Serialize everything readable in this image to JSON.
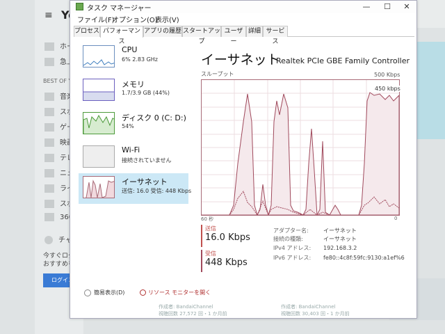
{
  "browser": {
    "menu_icon": "hamburger-icon",
    "logo": "Yo",
    "nav_items": [
      "ホー",
      "急上"
    ],
    "section_title": "BEST OF YO",
    "categories": [
      "音楽",
      "スポ",
      "ゲー",
      "映画",
      "テレ",
      "ニュ",
      "ライ",
      "スポ",
      "360"
    ],
    "channels_label": "チャ",
    "promo_line1": "今すぐログ",
    "promo_line2": "おすすめを",
    "login_button": "ログイン"
  },
  "window": {
    "title": "タスク マネージャー",
    "menu": [
      "ファイル(F)",
      "オプション(O)",
      "表示(V)"
    ],
    "tabs": [
      "プロセス",
      "パフォーマンス",
      "アプリの履歴",
      "スタートアップ",
      "ユーザー",
      "詳細",
      "サービス"
    ],
    "active_tab": "パフォーマンス"
  },
  "perf_items": [
    {
      "name": "CPU",
      "sub": "6% 2.83 GHz"
    },
    {
      "name": "メモリ",
      "sub": "1.7/3.9 GB (44%)"
    },
    {
      "name": "ディスク 0 (C: D:)",
      "sub": "54%"
    },
    {
      "name": "Wi-Fi",
      "sub": "接続されていません"
    },
    {
      "name": "イーサネット",
      "sub": "送信: 16.0 受信: 448 Kbps"
    }
  ],
  "pane": {
    "title": "イーサネット",
    "adapter": "Realtek PCIe GBE Family Controller",
    "throughput_label": "スループット",
    "max_label": "500 Kbps",
    "scale_label": "450 kbps",
    "axis_left": "60 秒",
    "axis_right": "0"
  },
  "stats": {
    "send_label": "送信",
    "send_value": "16.0 Kbps",
    "recv_label": "受信",
    "recv_value": "448 Kbps"
  },
  "details": [
    {
      "k": "アダプター名:",
      "v": "イーサネット"
    },
    {
      "k": "接続の種類:",
      "v": "イーサネット"
    },
    {
      "k": "IPv4 アドレス:",
      "v": "192.168.3.2"
    },
    {
      "k": "IPv6 アドレス:",
      "v": "fe80::4c8f:59fc:9130:a1ef%6"
    }
  ],
  "footer": {
    "summary": "簡易表示(D)",
    "monitor": "リソース モニターを開く"
  },
  "bottom": {
    "left1": "作成者: BandaiChannel",
    "left2": "視聴回数 27,572 回・1 か月前",
    "right1": "作成者: BandaiChannel",
    "right2": "視聴回数 30,403 回・1 か月前"
  }
}
